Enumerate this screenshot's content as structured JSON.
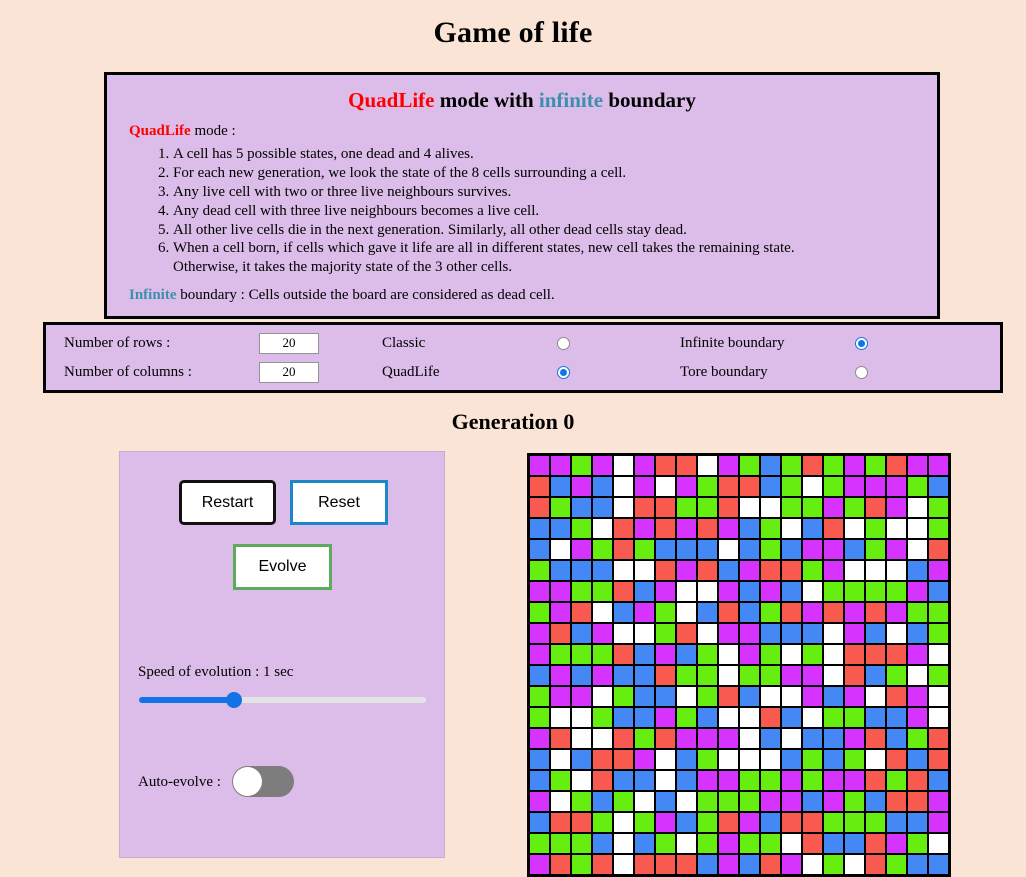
{
  "page_title": "Game of life",
  "info": {
    "title_parts": {
      "mode": "QuadLife",
      "middle": " mode with ",
      "boundary": "infinite",
      "suffix": " boundary"
    },
    "mode_label_strong": "QuadLife",
    "mode_label_rest": " mode :",
    "rules": [
      "A cell has 5 possible states, one dead and 4 alives.",
      "For each new generation, we look the state of the 8 cells surrounding a cell.",
      "Any live cell with two or three live neighbours survives.",
      "Any dead cell with three live neighbours becomes a live cell.",
      "All other live cells die in the next generation. Similarly, all other dead cells stay dead.",
      "When a cell born, if cells which gave it life are all in different states, new cell takes the remaining state."
    ],
    "rule6_continuation": "Otherwise, it takes the majority state of the 3 other cells.",
    "boundary_strong": "Infinite",
    "boundary_rest": " boundary : Cells outside the board are considered as dead cell."
  },
  "settings": {
    "rows_label": "Number of rows :",
    "rows_value": "20",
    "cols_label": "Number of columns :",
    "cols_value": "20",
    "mode_classic_label": "Classic",
    "mode_classic_selected": false,
    "mode_quadlife_label": "QuadLife",
    "mode_quadlife_selected": true,
    "boundary_infinite_label": "Infinite boundary",
    "boundary_infinite_selected": true,
    "boundary_tore_label": "Tore boundary",
    "boundary_tore_selected": false
  },
  "generation_label": "Generation 0",
  "controls": {
    "restart_label": "Restart",
    "reset_label": "Reset",
    "evolve_label": "Evolve",
    "speed_label": "Speed of evolution : 1 sec",
    "speed_percent": 33,
    "auto_evolve_label": "Auto-evolve :",
    "auto_evolve_on": false
  },
  "colors": {
    "background": "#f9e4d5",
    "panel": "#dcbde9",
    "accent_red": "#ff0000",
    "accent_teal": "#3d8fae",
    "radio_blue": "#1273e6",
    "restart_border": "#111111",
    "reset_border": "#1b87c9",
    "evolve_border": "#5cab5c",
    "cell_dead": "#ffffff",
    "cell_magenta": "#d633ff",
    "cell_red": "#f95a50",
    "cell_blue": "#4488f5",
    "cell_green": "#66ee11"
  },
  "board": {
    "rows": 20,
    "cols": 20,
    "legend": {
      "0": "dead",
      "1": "magenta",
      "2": "red",
      "3": "blue",
      "4": "green"
    },
    "cells": [
      [
        1,
        1,
        4,
        1,
        0,
        1,
        2,
        2,
        0,
        1,
        4,
        3,
        4,
        2,
        4,
        1,
        4,
        2,
        1,
        1
      ],
      [
        2,
        3,
        1,
        3,
        0,
        1,
        0,
        1,
        4,
        2,
        2,
        3,
        4,
        0,
        4,
        1,
        1,
        1,
        4,
        3
      ],
      [
        2,
        4,
        3,
        3,
        0,
        2,
        2,
        4,
        4,
        2,
        0,
        0,
        4,
        4,
        1,
        4,
        2,
        1,
        0,
        4
      ],
      [
        3,
        3,
        4,
        0,
        2,
        1,
        2,
        1,
        2,
        1,
        3,
        4,
        0,
        3,
        2,
        0,
        4,
        0,
        0,
        4
      ],
      [
        3,
        0,
        1,
        4,
        2,
        4,
        3,
        3,
        3,
        0,
        3,
        4,
        3,
        1,
        1,
        3,
        4,
        1,
        0,
        2
      ],
      [
        4,
        3,
        3,
        3,
        0,
        0,
        2,
        1,
        2,
        3,
        1,
        2,
        2,
        4,
        1,
        0,
        0,
        0,
        3,
        1
      ],
      [
        1,
        1,
        4,
        4,
        2,
        3,
        1,
        0,
        0,
        1,
        3,
        1,
        3,
        0,
        4,
        4,
        4,
        4,
        1,
        3
      ],
      [
        4,
        1,
        2,
        0,
        3,
        1,
        4,
        0,
        3,
        2,
        3,
        4,
        2,
        1,
        2,
        1,
        2,
        1,
        4,
        4
      ],
      [
        1,
        2,
        3,
        1,
        0,
        0,
        4,
        2,
        0,
        1,
        1,
        3,
        3,
        3,
        0,
        1,
        3,
        0,
        3,
        4
      ],
      [
        1,
        4,
        4,
        4,
        2,
        3,
        1,
        3,
        4,
        0,
        1,
        4,
        0,
        4,
        0,
        2,
        2,
        2,
        1,
        0
      ],
      [
        3,
        1,
        3,
        1,
        3,
        3,
        2,
        4,
        4,
        0,
        4,
        4,
        1,
        1,
        0,
        2,
        3,
        4,
        0,
        4
      ],
      [
        4,
        1,
        1,
        0,
        4,
        3,
        3,
        0,
        4,
        2,
        3,
        0,
        0,
        1,
        3,
        1,
        0,
        2,
        1,
        0
      ],
      [
        4,
        0,
        0,
        4,
        3,
        3,
        1,
        4,
        3,
        0,
        0,
        2,
        3,
        0,
        4,
        4,
        3,
        3,
        1,
        0
      ],
      [
        1,
        2,
        0,
        0,
        2,
        4,
        2,
        1,
        1,
        1,
        0,
        3,
        0,
        3,
        3,
        1,
        2,
        3,
        4,
        2
      ],
      [
        3,
        0,
        3,
        2,
        2,
        1,
        0,
        3,
        4,
        0,
        0,
        0,
        3,
        4,
        3,
        4,
        0,
        2,
        3,
        2
      ],
      [
        3,
        4,
        0,
        2,
        3,
        3,
        0,
        3,
        1,
        1,
        4,
        4,
        1,
        4,
        1,
        1,
        2,
        4,
        2,
        3
      ],
      [
        1,
        0,
        4,
        3,
        4,
        0,
        3,
        0,
        4,
        4,
        4,
        1,
        1,
        3,
        1,
        4,
        3,
        2,
        2,
        1
      ],
      [
        3,
        2,
        2,
        4,
        0,
        4,
        1,
        3,
        4,
        2,
        1,
        3,
        2,
        2,
        4,
        4,
        4,
        3,
        3,
        1
      ],
      [
        4,
        4,
        4,
        3,
        0,
        3,
        4,
        0,
        4,
        1,
        4,
        4,
        0,
        2,
        3,
        3,
        2,
        1,
        4,
        0
      ],
      [
        1,
        2,
        4,
        2,
        0,
        2,
        2,
        2,
        3,
        1,
        3,
        2,
        1,
        0,
        4,
        0,
        2,
        4,
        3,
        3
      ]
    ]
  }
}
